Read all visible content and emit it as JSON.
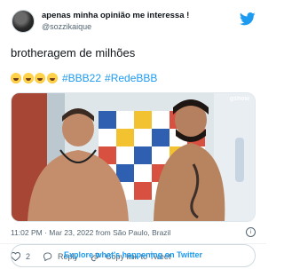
{
  "tweet": {
    "display_name": "apenas minha opinião me interessa !",
    "handle": "@sozzikaique",
    "text": "brotheragem de milhões",
    "emoji_count": 4,
    "hashtags": [
      "#BBB22",
      "#RedeBBB"
    ],
    "timestamp": "11:02 PM · Mar 23, 2022 from São Paulo, Brazil",
    "replies_count": "2",
    "reply_label": "Reply",
    "copy_link_label": "Copy link to Tweet",
    "explore_label": "Explore what's happening on Twitter",
    "watermark": "gshow"
  },
  "icons": {
    "brand": "twitter-bird-icon",
    "info": "info-icon",
    "like": "heart-icon",
    "reply": "reply-bubble-icon",
    "copy_link": "link-icon"
  },
  "colors": {
    "brand_blue": "#1d9bf0",
    "secondary_text": "#536471"
  }
}
